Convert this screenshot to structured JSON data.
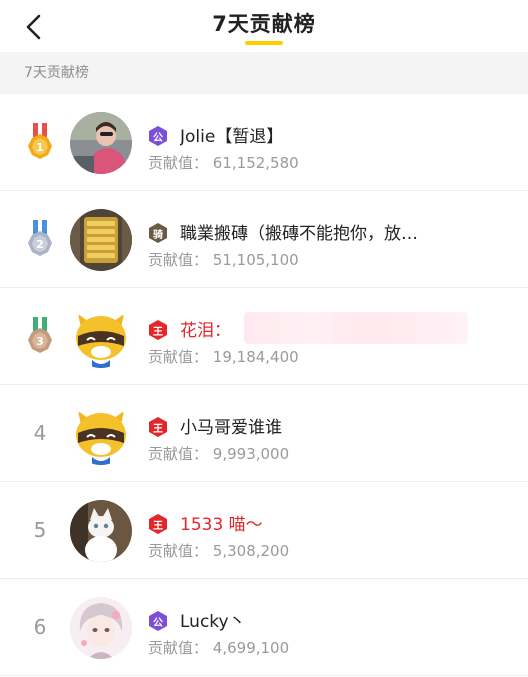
{
  "header": {
    "title": "7天贡献榜"
  },
  "section": {
    "label": "7天贡献榜"
  },
  "contrib_prefix": "贡献值：",
  "colors": {
    "accent": "#ffcc00",
    "highlight_name": "#e4262a",
    "gold": "#f2a91b",
    "silver": "#aab4c4",
    "bronze": "#c49a7c"
  },
  "ranks": [
    {
      "rank": "1",
      "medal": "gold",
      "badge": "公",
      "badge_color": "#7b4fd6",
      "name": "Jolie【暂退】",
      "value": "61,152,580",
      "avatar": "person-photo"
    },
    {
      "rank": "2",
      "medal": "silver",
      "badge": "骑",
      "badge_color": "#6b5a44",
      "name": "職業搬磚（搬磚不能抱你，放…",
      "value": "51,105,100",
      "avatar": "gold-bars"
    },
    {
      "rank": "3",
      "medal": "bronze",
      "badge": "王",
      "badge_color": "#e4262a",
      "name": "花泪：",
      "value": "19,184,400",
      "avatar": "raccoon-mascot"
    },
    {
      "rank": "4",
      "medal": "",
      "badge": "王",
      "badge_color": "#e4262a",
      "name": "小马哥爱谁谁",
      "value": "9,993,000",
      "avatar": "raccoon-mascot"
    },
    {
      "rank": "5",
      "medal": "",
      "badge": "王",
      "badge_color": "#e4262a",
      "name": "1533 喵～",
      "value": "5,308,200",
      "avatar": "white-cat"
    },
    {
      "rank": "6",
      "medal": "",
      "badge": "公",
      "badge_color": "#7b4fd6",
      "name": "Lucky丶",
      "value": "4,699,100",
      "avatar": "anime-boy"
    }
  ]
}
